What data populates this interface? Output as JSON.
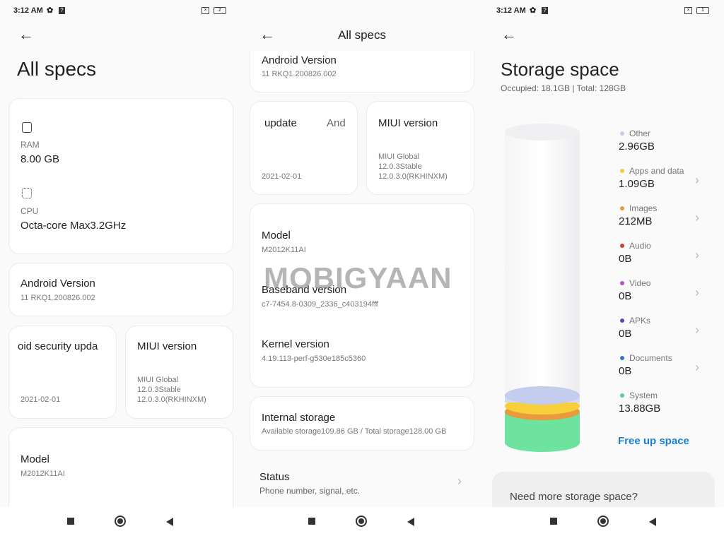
{
  "status": {
    "time": "3:12 AM",
    "battery_1": "2",
    "battery_2": "2",
    "battery_3": "1",
    "sim": "×"
  },
  "panel1": {
    "title": "All specs",
    "ram_label": "RAM",
    "ram_value": "8.00 GB",
    "cpu_label": "CPU",
    "cpu_value": "Octa-core Max3.2GHz",
    "android_label": "Android Version",
    "android_value": "11 RKQ1.200826.002",
    "security_label": "oid security upda",
    "security_value": "2021-02-01",
    "miui_label": "MIUI version",
    "miui_lines": [
      "MIUI Global",
      "12.0.3Stable",
      "12.0.3.0(RKHINXM)"
    ],
    "model_label": "Model",
    "model_value": "M2012K11AI"
  },
  "panel2": {
    "title": "All specs",
    "android_label": "Android Version",
    "android_value": "11 RKQ1.200826.002",
    "security_label": "update",
    "security_label_2": "And",
    "security_value": "2021-02-01",
    "miui_label": "MIUI version",
    "miui_lines": [
      "MIUI Global",
      "12.0.3Stable",
      "12.0.3.0(RKHINXM)"
    ],
    "model_label": "Model",
    "model_value": "M2012K11AI",
    "baseband_label": "Baseband version",
    "baseband_value": "c7-7454.8-0309_2336_c403194fff",
    "kernel_label": "Kernel version",
    "kernel_value": "4.19.113-perf-g530e185c5360",
    "storage_label": "Internal storage",
    "storage_value": "Available storage109.86 GB / Total storage128.00 GB",
    "status_label": "Status",
    "status_sub": "Phone number, signal, etc.",
    "watermark": "MOBIGYAAN"
  },
  "panel3": {
    "title": "Storage space",
    "summary": "Occupied: 18.1GB | Total: 128GB",
    "categories": [
      {
        "label": "Other",
        "value": "2.96GB",
        "color": "#c9cbe6",
        "chevron": false
      },
      {
        "label": "Apps and data",
        "value": "1.09GB",
        "color": "#f2cc3c",
        "chevron": true
      },
      {
        "label": "Images",
        "value": "212MB",
        "color": "#e89a3c",
        "chevron": true
      },
      {
        "label": "Audio",
        "value": "0B",
        "color": "#d23c3c",
        "chevron": true
      },
      {
        "label": "Video",
        "value": "0B",
        "color": "#b44fd0",
        "chevron": true
      },
      {
        "label": "APKs",
        "value": "0B",
        "color": "#6a3fc4",
        "chevron": true
      },
      {
        "label": "Documents",
        "value": "0B",
        "color": "#2f74c8",
        "chevron": true
      },
      {
        "label": "System",
        "value": "13.88GB",
        "color": "#5fd08a",
        "chevron": false
      }
    ],
    "free_up": "Free up space",
    "more": "Need more storage space?",
    "accent": "#1a7fd4"
  }
}
